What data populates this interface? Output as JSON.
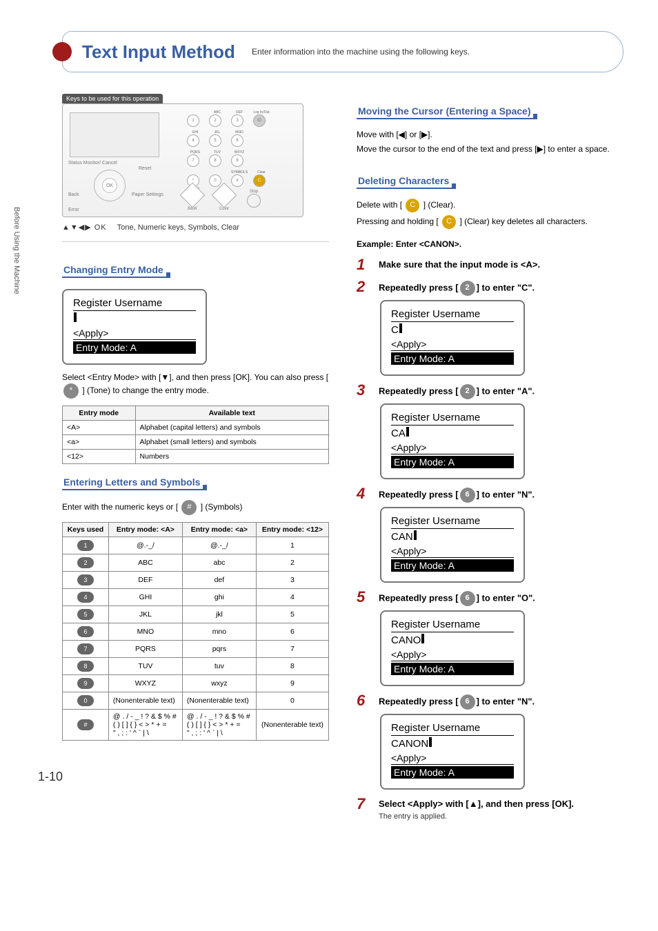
{
  "sidebar_text": "Before Using the Machine",
  "page_number": "1-10",
  "title": {
    "heading": "Text Input Method",
    "description": "Enter information into the machine using the following keys."
  },
  "panel": {
    "header_label": "Keys to be used for this operation",
    "caption_prefix": "▲▼◀▶ OK",
    "caption_rest": "Tone, Numeric keys, Symbols, Clear",
    "labels": {
      "status": "Status Monitor/\nCancel",
      "reset": "Reset",
      "back": "Back",
      "error": "Error",
      "paper": "Paper Settings",
      "login": "Log In/Out",
      "clear": "Clear",
      "symbols": "SYMBOLS",
      "tone": "Tone",
      "bw": "B&W",
      "color": "Color",
      "stop": "Stop"
    },
    "keypad_rows": [
      [
        "",
        "ABC",
        "DEF",
        ""
      ],
      [
        "GHI",
        "JKL",
        "MNO",
        ""
      ],
      [
        "PQRS",
        "TUV",
        "WXYZ",
        ""
      ],
      [
        "",
        "",
        "",
        ""
      ]
    ]
  },
  "changing_mode": {
    "heading": "Changing Entry Mode",
    "lcd": {
      "title": "Register Username",
      "line2": "",
      "apply": "<Apply>",
      "mode": "Entry Mode: A"
    },
    "para": "Select <Entry Mode> with [▼], and then press [OK]. You can also press [",
    "para_after": "] (Tone) to change the entry mode.",
    "tone_key": "*",
    "table": {
      "headers": [
        "Entry mode",
        "Available text"
      ],
      "rows": [
        [
          "<A>",
          "Alphabet (capital letters) and symbols"
        ],
        [
          "<a>",
          "Alphabet (small letters) and symbols"
        ],
        [
          "<12>",
          "Numbers"
        ]
      ]
    }
  },
  "entering_letters": {
    "heading": "Entering Letters and Symbols",
    "para_before": "Enter with the numeric keys or [",
    "para_after": "] (Symbols)",
    "hash_key": "#",
    "table": {
      "headers": [
        "Keys used",
        "Entry mode: <A>",
        "Entry mode: <a>",
        "Entry mode: <12>"
      ],
      "rows": [
        {
          "key": "1",
          "A": "@.-_/",
          "a": "@.-_/",
          "n": "1"
        },
        {
          "key": "2",
          "A": "ABC",
          "a": "abc",
          "n": "2"
        },
        {
          "key": "3",
          "A": "DEF",
          "a": "def",
          "n": "3"
        },
        {
          "key": "4",
          "A": "GHI",
          "a": "ghi",
          "n": "4"
        },
        {
          "key": "5",
          "A": "JKL",
          "a": "jkl",
          "n": "5"
        },
        {
          "key": "6",
          "A": "MNO",
          "a": "mno",
          "n": "6"
        },
        {
          "key": "7",
          "A": "PQRS",
          "a": "pqrs",
          "n": "7"
        },
        {
          "key": "8",
          "A": "TUV",
          "a": "tuv",
          "n": "8"
        },
        {
          "key": "9",
          "A": "WXYZ",
          "a": "wxyz",
          "n": "9"
        },
        {
          "key": "0",
          "A": "(Nonenterable text)",
          "a": "(Nonenterable text)",
          "n": "0"
        },
        {
          "key": "#",
          "A": "@ . / - _ ! ? & $ % #\n( ) [ ] { } < > * + =\n\" , ; : ' ^ ` | \\",
          "a": "@ . / - _ ! ? & $ % #\n( ) [ ] { } < > * + =\n\" , ; : ' ^ ` | \\",
          "n": "(Nonenterable text)"
        }
      ]
    }
  },
  "right": {
    "moving": {
      "heading": "Moving the Cursor (Entering a Space)",
      "line1": "Move with [◀] or [▶].",
      "line2": "Move the cursor to the end of the text and press [▶] to enter a space."
    },
    "deleting": {
      "heading": "Deleting Characters",
      "line1_a": "Delete with [",
      "line1_b": "] (Clear).",
      "line2_a": "Pressing and holding [",
      "line2_b": "] (Clear) key deletes all characters.",
      "clear_glyph": "C"
    },
    "example_heading": "Example: Enter <CANON>.",
    "steps": [
      {
        "num": "1",
        "text": "Make sure that the input mode is <A>."
      },
      {
        "num": "2",
        "text_a": "Repeatedly press [",
        "key": "2",
        "text_b": "] to enter \"C\".",
        "lcd": {
          "title": "Register Username",
          "line2": "C",
          "apply": "<Apply>",
          "mode": "Entry Mode: A"
        }
      },
      {
        "num": "3",
        "text_a": "Repeatedly press [",
        "key": "2",
        "text_b": "] to enter \"A\".",
        "lcd": {
          "title": "Register Username",
          "line2": "CA",
          "apply": "<Apply>",
          "mode": "Entry Mode: A"
        }
      },
      {
        "num": "4",
        "text_a": "Repeatedly press [",
        "key": "6",
        "text_b": "] to enter \"N\".",
        "lcd": {
          "title": "Register Username",
          "line2": "CAN",
          "apply": "<Apply>",
          "mode": "Entry Mode: A"
        }
      },
      {
        "num": "5",
        "text_a": "Repeatedly press [",
        "key": "6",
        "text_b": "] to enter \"O\".",
        "lcd": {
          "title": "Register Username",
          "line2": "CANO",
          "apply": "<Apply>",
          "mode": "Entry Mode: A"
        }
      },
      {
        "num": "6",
        "text_a": "Repeatedly press [",
        "key": "6",
        "text_b": "] to enter \"N\".",
        "lcd": {
          "title": "Register Username",
          "line2": "CANON",
          "apply": "<Apply>",
          "mode": "Entry Mode: A"
        }
      },
      {
        "num": "7",
        "text": "Select <Apply> with [▲], and then press [OK].",
        "sub": "The entry is applied."
      }
    ]
  }
}
